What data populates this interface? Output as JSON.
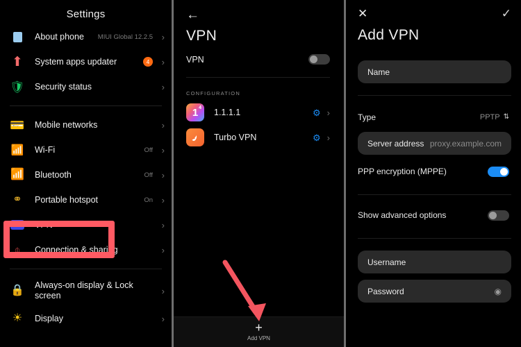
{
  "panel_settings": {
    "title": "Settings",
    "groups": [
      {
        "items": [
          {
            "icon": "about-phone-icon",
            "label": "About phone",
            "value": "MIUI Global 12.2.5",
            "badge": "",
            "chevron": "›"
          },
          {
            "icon": "system-apps-updater-icon",
            "label": "System apps updater",
            "value": "",
            "badge": "4",
            "chevron": "›"
          },
          {
            "icon": "security-status-icon",
            "label": "Security status",
            "value": "",
            "badge": "",
            "chevron": "›"
          }
        ]
      },
      {
        "items": [
          {
            "icon": "mobile-networks-icon",
            "label": "Mobile networks",
            "value": "",
            "badge": "",
            "chevron": "›"
          },
          {
            "icon": "wifi-icon",
            "label": "Wi-Fi",
            "value": "Off",
            "badge": "",
            "chevron": "›"
          },
          {
            "icon": "bluetooth-icon",
            "label": "Bluetooth",
            "value": "Off",
            "badge": "",
            "chevron": "›"
          },
          {
            "icon": "portable-hotspot-icon",
            "label": "Portable hotspot",
            "value": "On",
            "badge": "",
            "chevron": "›"
          },
          {
            "icon": "vpn-icon",
            "label": "VPN",
            "value": "",
            "badge": "",
            "chevron": "›"
          },
          {
            "icon": "connection-sharing-icon",
            "label": "Connection & sharing",
            "value": "",
            "badge": "",
            "chevron": "›"
          }
        ]
      },
      {
        "items": [
          {
            "icon": "lock-icon",
            "label": "Always-on display & Lock\nscreen",
            "value": "",
            "badge": "",
            "chevron": "›"
          },
          {
            "icon": "display-icon",
            "label": "Display",
            "value": "",
            "badge": "",
            "chevron": "›"
          }
        ]
      }
    ],
    "highlight_color": "#ff5a63",
    "vpn_icon_text": "VPN"
  },
  "panel_vpn": {
    "back_icon": "←",
    "heading": "VPN",
    "toggle_label": "VPN",
    "toggle_on": false,
    "section_label": "CONFIGURATION",
    "configs": [
      {
        "icon": "one-one-one-one-app-icon",
        "name": "1.1.1.1",
        "icon_text": "1",
        "icon_sup": "4",
        "gear": "gear-icon",
        "chevron": "›"
      },
      {
        "icon": "turbo-vpn-app-icon",
        "name": "Turbo VPN",
        "icon_text": "",
        "icon_sup": "",
        "gear": "gear-icon",
        "chevron": "›"
      }
    ],
    "add_button": {
      "plus": "+",
      "label": "Add VPN"
    },
    "arrow_color": "#f4555f"
  },
  "panel_add_vpn": {
    "close_icon": "✕",
    "confirm_icon": "✓",
    "heading": "Add VPN",
    "name_field": {
      "label": "Name",
      "placeholder": ""
    },
    "type_row": {
      "label": "Type",
      "value": "PPTP",
      "stepper": "⇅"
    },
    "server_field": {
      "label": "Server address",
      "placeholder": "proxy.example.com"
    },
    "ppp_row": {
      "label": "PPP encryption (MPPE)",
      "on": true
    },
    "advanced_row": {
      "label": "Show advanced options",
      "on": false
    },
    "username_field": {
      "label": "Username",
      "placeholder": ""
    },
    "password_field": {
      "label": "Password",
      "placeholder": "",
      "eye_icon": "◉"
    },
    "accent_color": "#1b8cf5"
  }
}
